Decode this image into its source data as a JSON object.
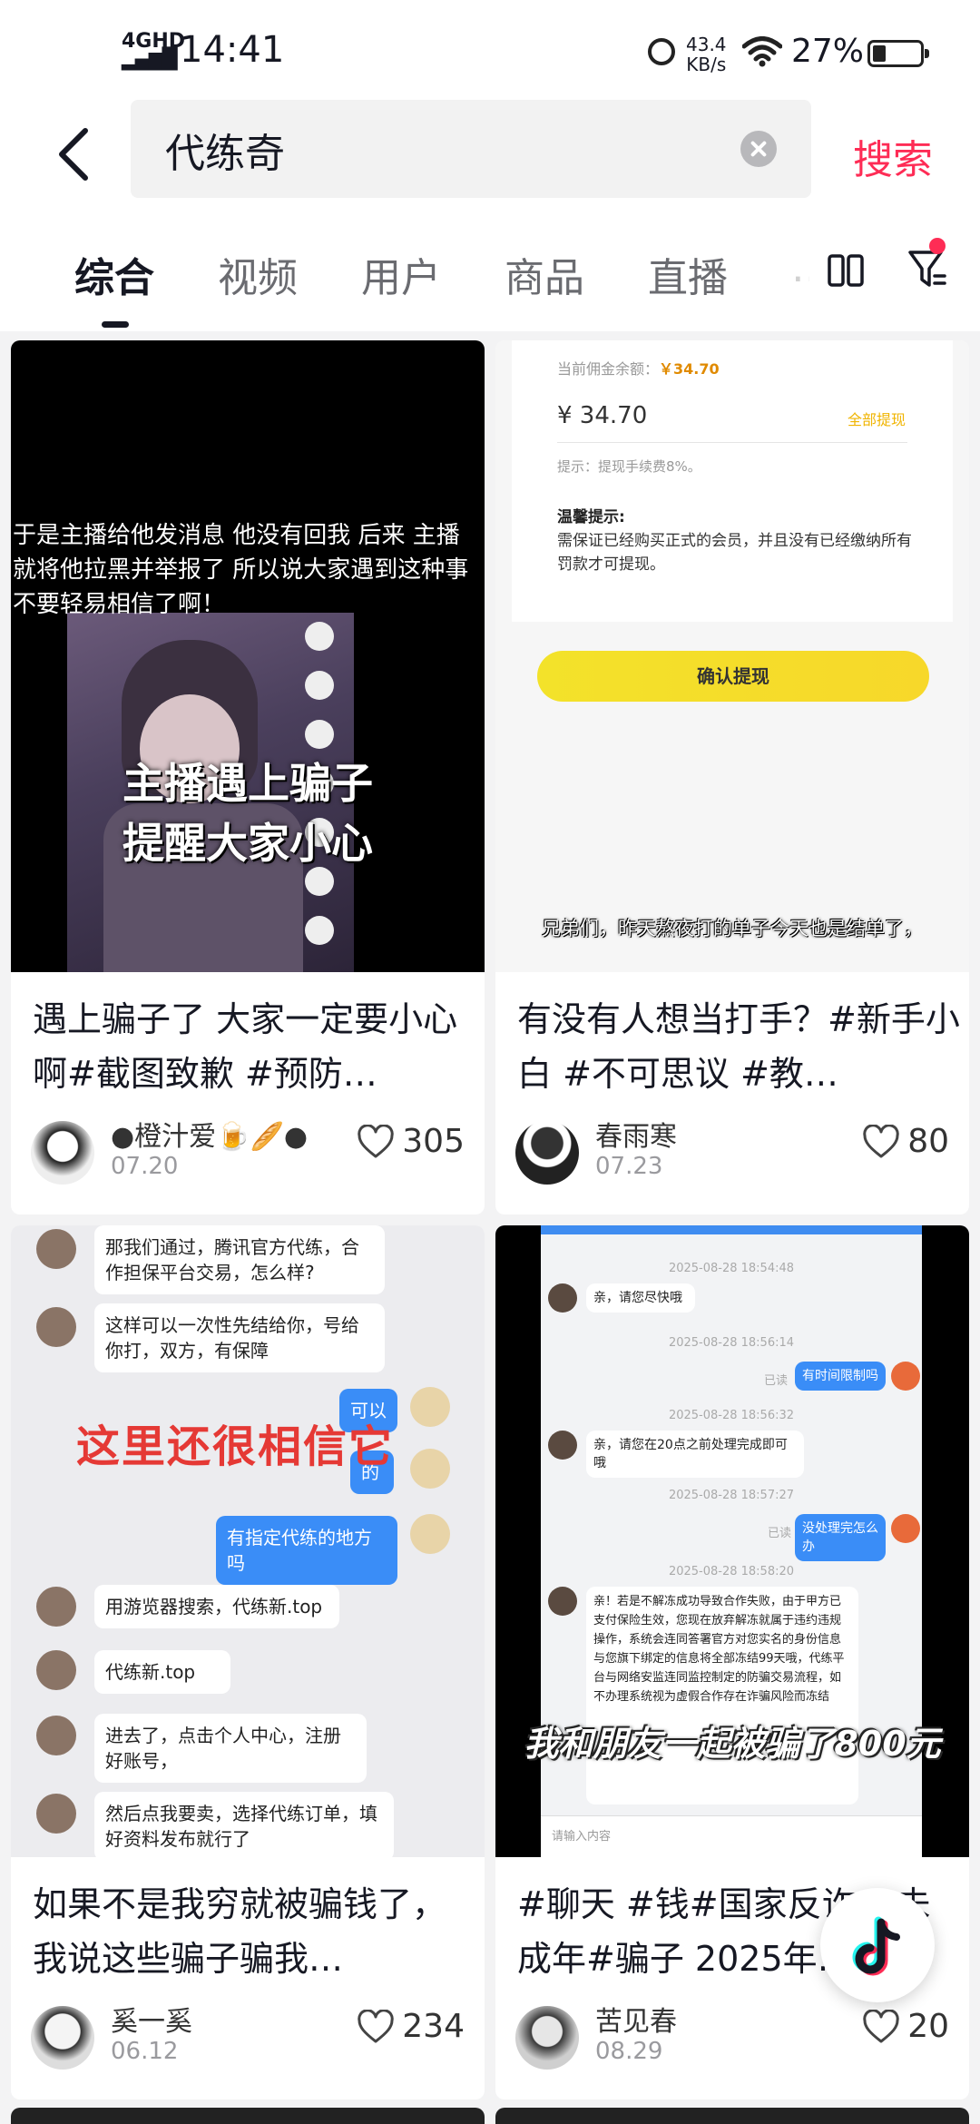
{
  "status_bar": {
    "network": "4GHD",
    "time": "14:41",
    "speed_value": "43.4",
    "speed_unit": "KB/s",
    "battery": "27%"
  },
  "search": {
    "query": "代练奇",
    "submit_label": "搜索"
  },
  "tabs": [
    {
      "label": "综合",
      "active": true
    },
    {
      "label": "视频"
    },
    {
      "label": "用户"
    },
    {
      "label": "商品"
    },
    {
      "label": "直播"
    }
  ],
  "accent_color": "#fe2c55",
  "cards": [
    {
      "title": "遇上骗子了 大家一定要小心啊#截图致歉 #预防…",
      "author": "●橙汁爱🍺🥖●",
      "date": "07.20",
      "likes": "305",
      "cover_text": "于是主播给他发消息 他没有回我 后来 主播就将他拉黑并举报了 所以说大家遇到这种事不要轻易相信了啊！",
      "cover_caption_1": "主播遇上骗子",
      "cover_caption_2": "提醒大家小心"
    },
    {
      "title": "有没有人想当打手？#新手小白 #不可思议 #教…",
      "author": "春雨寒",
      "date": "07.23",
      "likes": "80",
      "cover": {
        "balance_label": "当前佣金余额：",
        "balance_small": "￥34.70",
        "amount": "¥ 34.70",
        "withdraw_all": "全部提现",
        "fee_text": "提示：提现手续费8%。",
        "tip_title": "温馨提示:",
        "tip_body": "需保证已经购买正式的会员，并且没有已经缴纳所有罚款才可提现。",
        "confirm": "确认提现",
        "subtitle": "兄弟们，昨天熬夜打的单子今天也是结单了，"
      }
    },
    {
      "title": "如果不是我穷就被骗钱了，我说这些骗子骗我…",
      "author": "奚一奚",
      "date": "06.12",
      "likes": "234",
      "cover": {
        "msg1": "那我们通过，腾讯官方代练，合作担保平台交易，怎么样?",
        "msg2": "这样可以一次性先结给你，号给你打，双方，有保障",
        "me1": "可以",
        "me2": "的",
        "me3": "有指定代练的地方吗",
        "msg3": "用游览器搜索，代练新.top",
        "msg4": "代练新.top",
        "msg5": "进去了，点击个人中心，注册好账号，",
        "msg6": "然后点我要卖，选择代练订单，填好资料发布就行了",
        "overlay": "这里还很相信它"
      }
    },
    {
      "title": "#聊天 #钱#国家反诈 #未成年#骗子 2025年…",
      "author": "苦见春",
      "date": "08.29",
      "likes": "20",
      "cover": {
        "ts1": "2025-08-28 18:54:48",
        "msg1": "亲，请您尽快哦",
        "ts2": "2025-08-28 18:56:14",
        "read1": "已读",
        "me1": "有时间限制吗",
        "ts3": "2025-08-28 18:56:32",
        "msg2": "亲，请您在20点之前处理完成即可哦",
        "ts4": "2025-08-28 18:57:27",
        "read2": "已读",
        "me2": "没处理完怎么办",
        "ts5": "2025-08-28 18:58:20",
        "msg3": "亲！若是不解冻成功导致合作失败，由于甲方已支付保险生效，您现在放弃解冻就属于违约违规操作，系统会连同答署官方对您实名的身份信息与您旗下绑定的信息将全部冻结99天哦，代练平台与网络安监连同监控制定的防骗交易流程，如不办理系统视为虚假合作存在诈骗风险而冻结",
        "input_placeholder": "请输入内容",
        "overlay": "我和朋友一起被骗了800元"
      }
    }
  ]
}
